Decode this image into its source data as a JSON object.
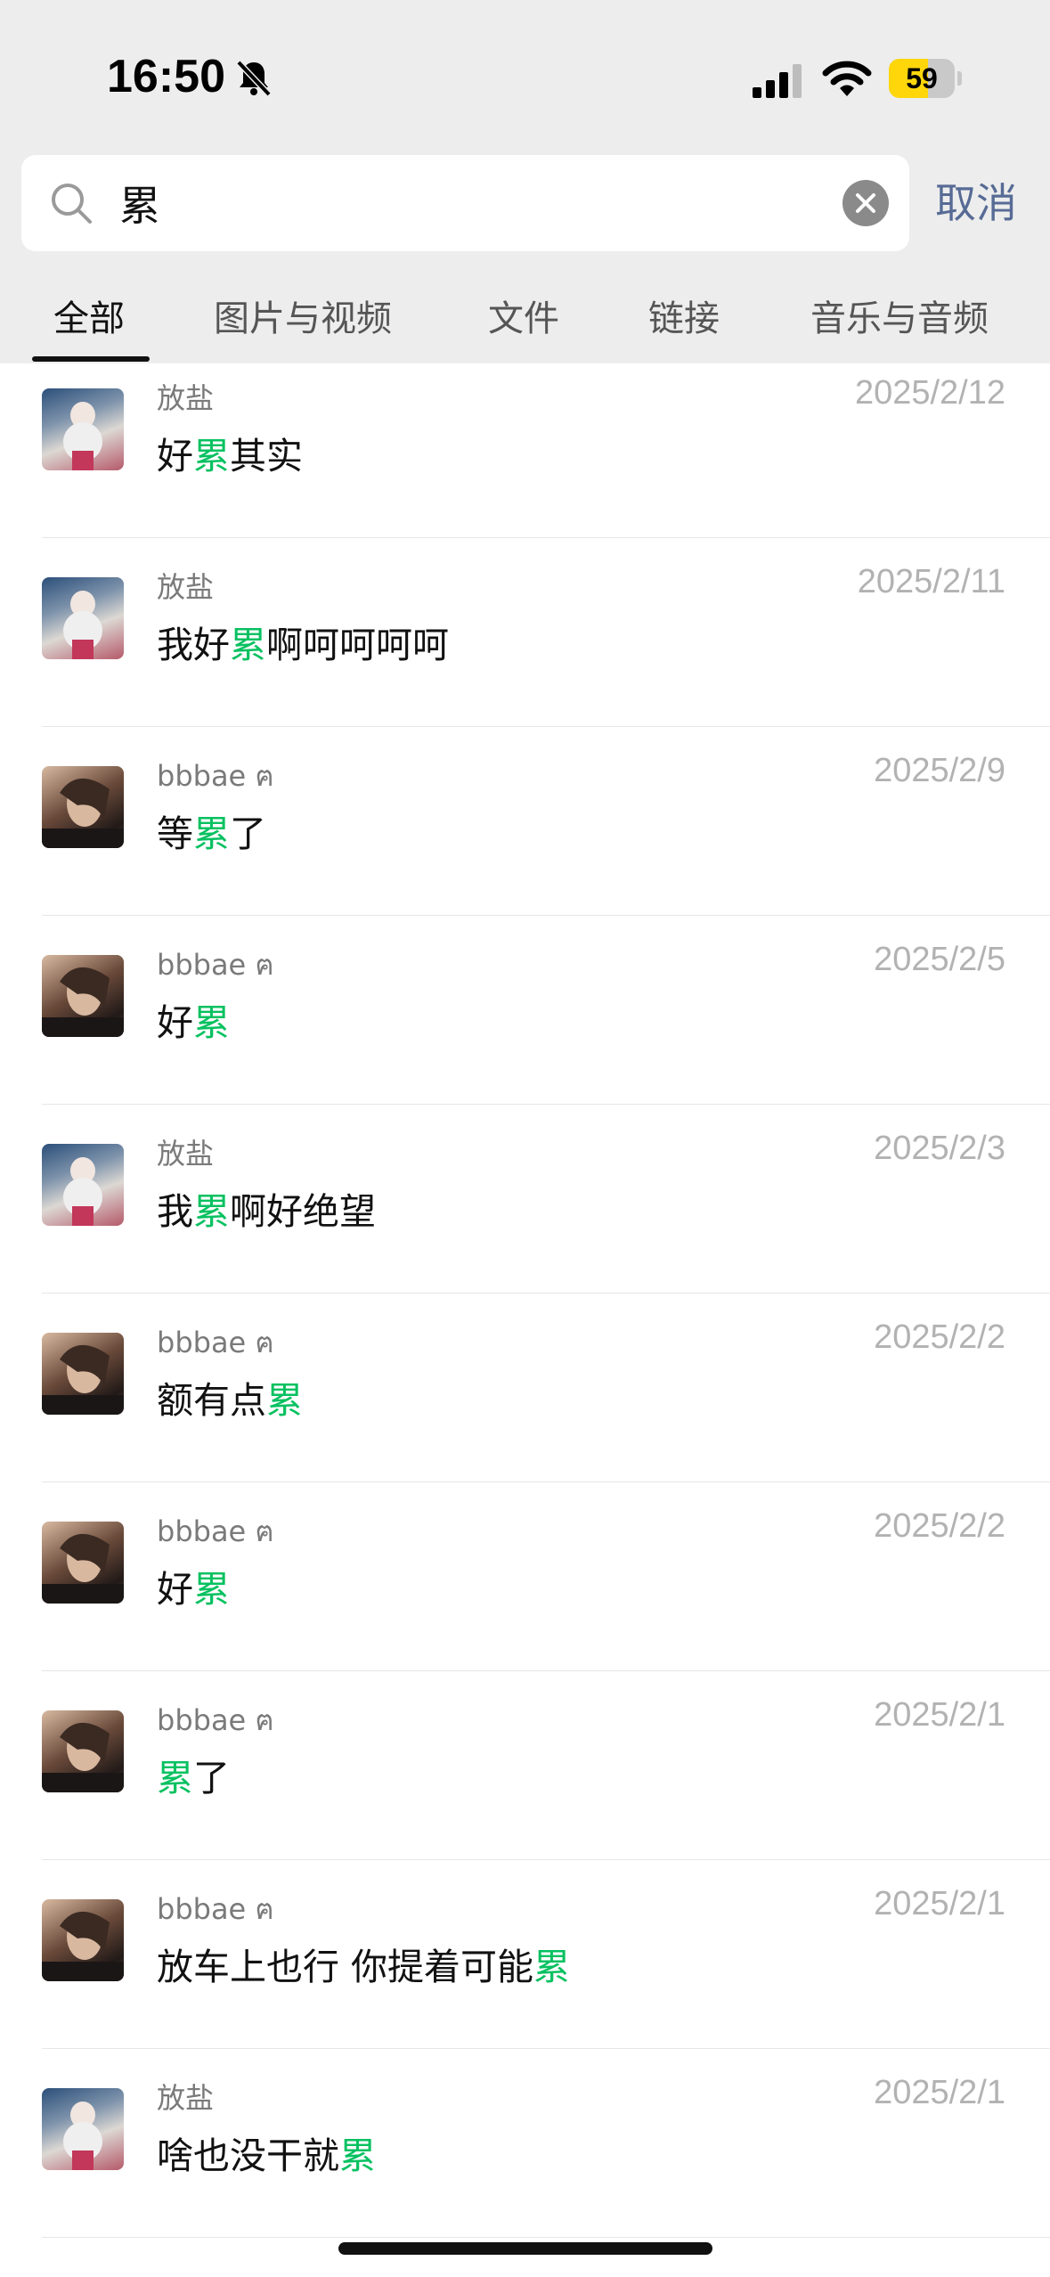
{
  "status": {
    "time": "16:50",
    "battery_level": "59",
    "battery_fraction": 0.59,
    "icons": [
      "bell-slash-icon",
      "signal-icon",
      "wifi-icon",
      "battery-icon"
    ]
  },
  "search": {
    "query": "累",
    "cancel_label": "取消"
  },
  "tabs": [
    "全部",
    "图片与视频",
    "文件",
    "链接",
    "音乐与音频"
  ],
  "active_tab": 0,
  "colors": {
    "highlight": "#07c160",
    "link": "#576b95"
  },
  "results": [
    {
      "sender": "放盐",
      "date": "2025/2/12",
      "avatar": "avatar-a",
      "pre": "好",
      "match": "累",
      "post": "其实"
    },
    {
      "sender": "放盐",
      "date": "2025/2/11",
      "avatar": "avatar-a",
      "pre": "我好",
      "match": "累",
      "post": "啊呵呵呵呵"
    },
    {
      "sender": "bbbae ฅ",
      "date": "2025/2/9",
      "avatar": "avatar-b",
      "pre": "等",
      "match": "累",
      "post": "了"
    },
    {
      "sender": "bbbae ฅ",
      "date": "2025/2/5",
      "avatar": "avatar-b",
      "pre": "好",
      "match": "累",
      "post": ""
    },
    {
      "sender": "放盐",
      "date": "2025/2/3",
      "avatar": "avatar-a",
      "pre": "我",
      "match": "累",
      "post": "啊好绝望"
    },
    {
      "sender": "bbbae ฅ",
      "date": "2025/2/2",
      "avatar": "avatar-b",
      "pre": "额有点",
      "match": "累",
      "post": ""
    },
    {
      "sender": "bbbae ฅ",
      "date": "2025/2/2",
      "avatar": "avatar-b",
      "pre": "好",
      "match": "累",
      "post": ""
    },
    {
      "sender": "bbbae ฅ",
      "date": "2025/2/1",
      "avatar": "avatar-b",
      "pre": "",
      "match": "累",
      "post": "了"
    },
    {
      "sender": "bbbae ฅ",
      "date": "2025/2/1",
      "avatar": "avatar-b",
      "pre": "放车上也行 你提着可能",
      "match": "累",
      "post": ""
    },
    {
      "sender": "放盐",
      "date": "2025/2/1",
      "avatar": "avatar-a",
      "pre": "啥也没干就",
      "match": "累",
      "post": ""
    }
  ]
}
